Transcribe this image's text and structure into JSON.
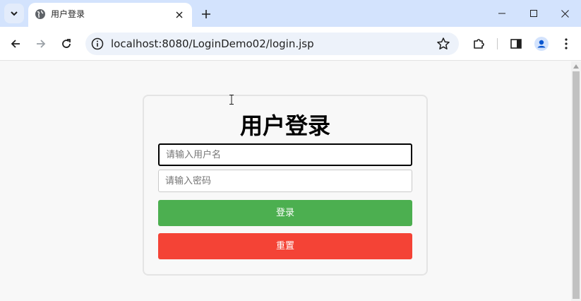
{
  "tab": {
    "title": "用户登录",
    "favicon": "globe-icon",
    "close_icon": "close-icon"
  },
  "toolbar": {
    "url": "localhost:8080/LoginDemo02/login.jsp",
    "icons": [
      "back-arrow-icon",
      "forward-arrow-icon",
      "reload-icon",
      "site-info-icon",
      "star-icon",
      "extensions-icon",
      "side-panel-icon",
      "profile-avatar-icon",
      "more-menu-icon"
    ]
  },
  "window_controls": [
    "minimize-icon",
    "maximize-icon",
    "close-window-icon"
  ],
  "login": {
    "title": "用户登录",
    "username_placeholder": "请输入用户名",
    "password_placeholder": "请输入密码",
    "login_label": "登录",
    "reset_label": "重置"
  },
  "colors": {
    "tabstrip": "#d3e3fd",
    "login_button": "#4caf50",
    "reset_button": "#f44336",
    "avatar": "#0b57d0"
  }
}
